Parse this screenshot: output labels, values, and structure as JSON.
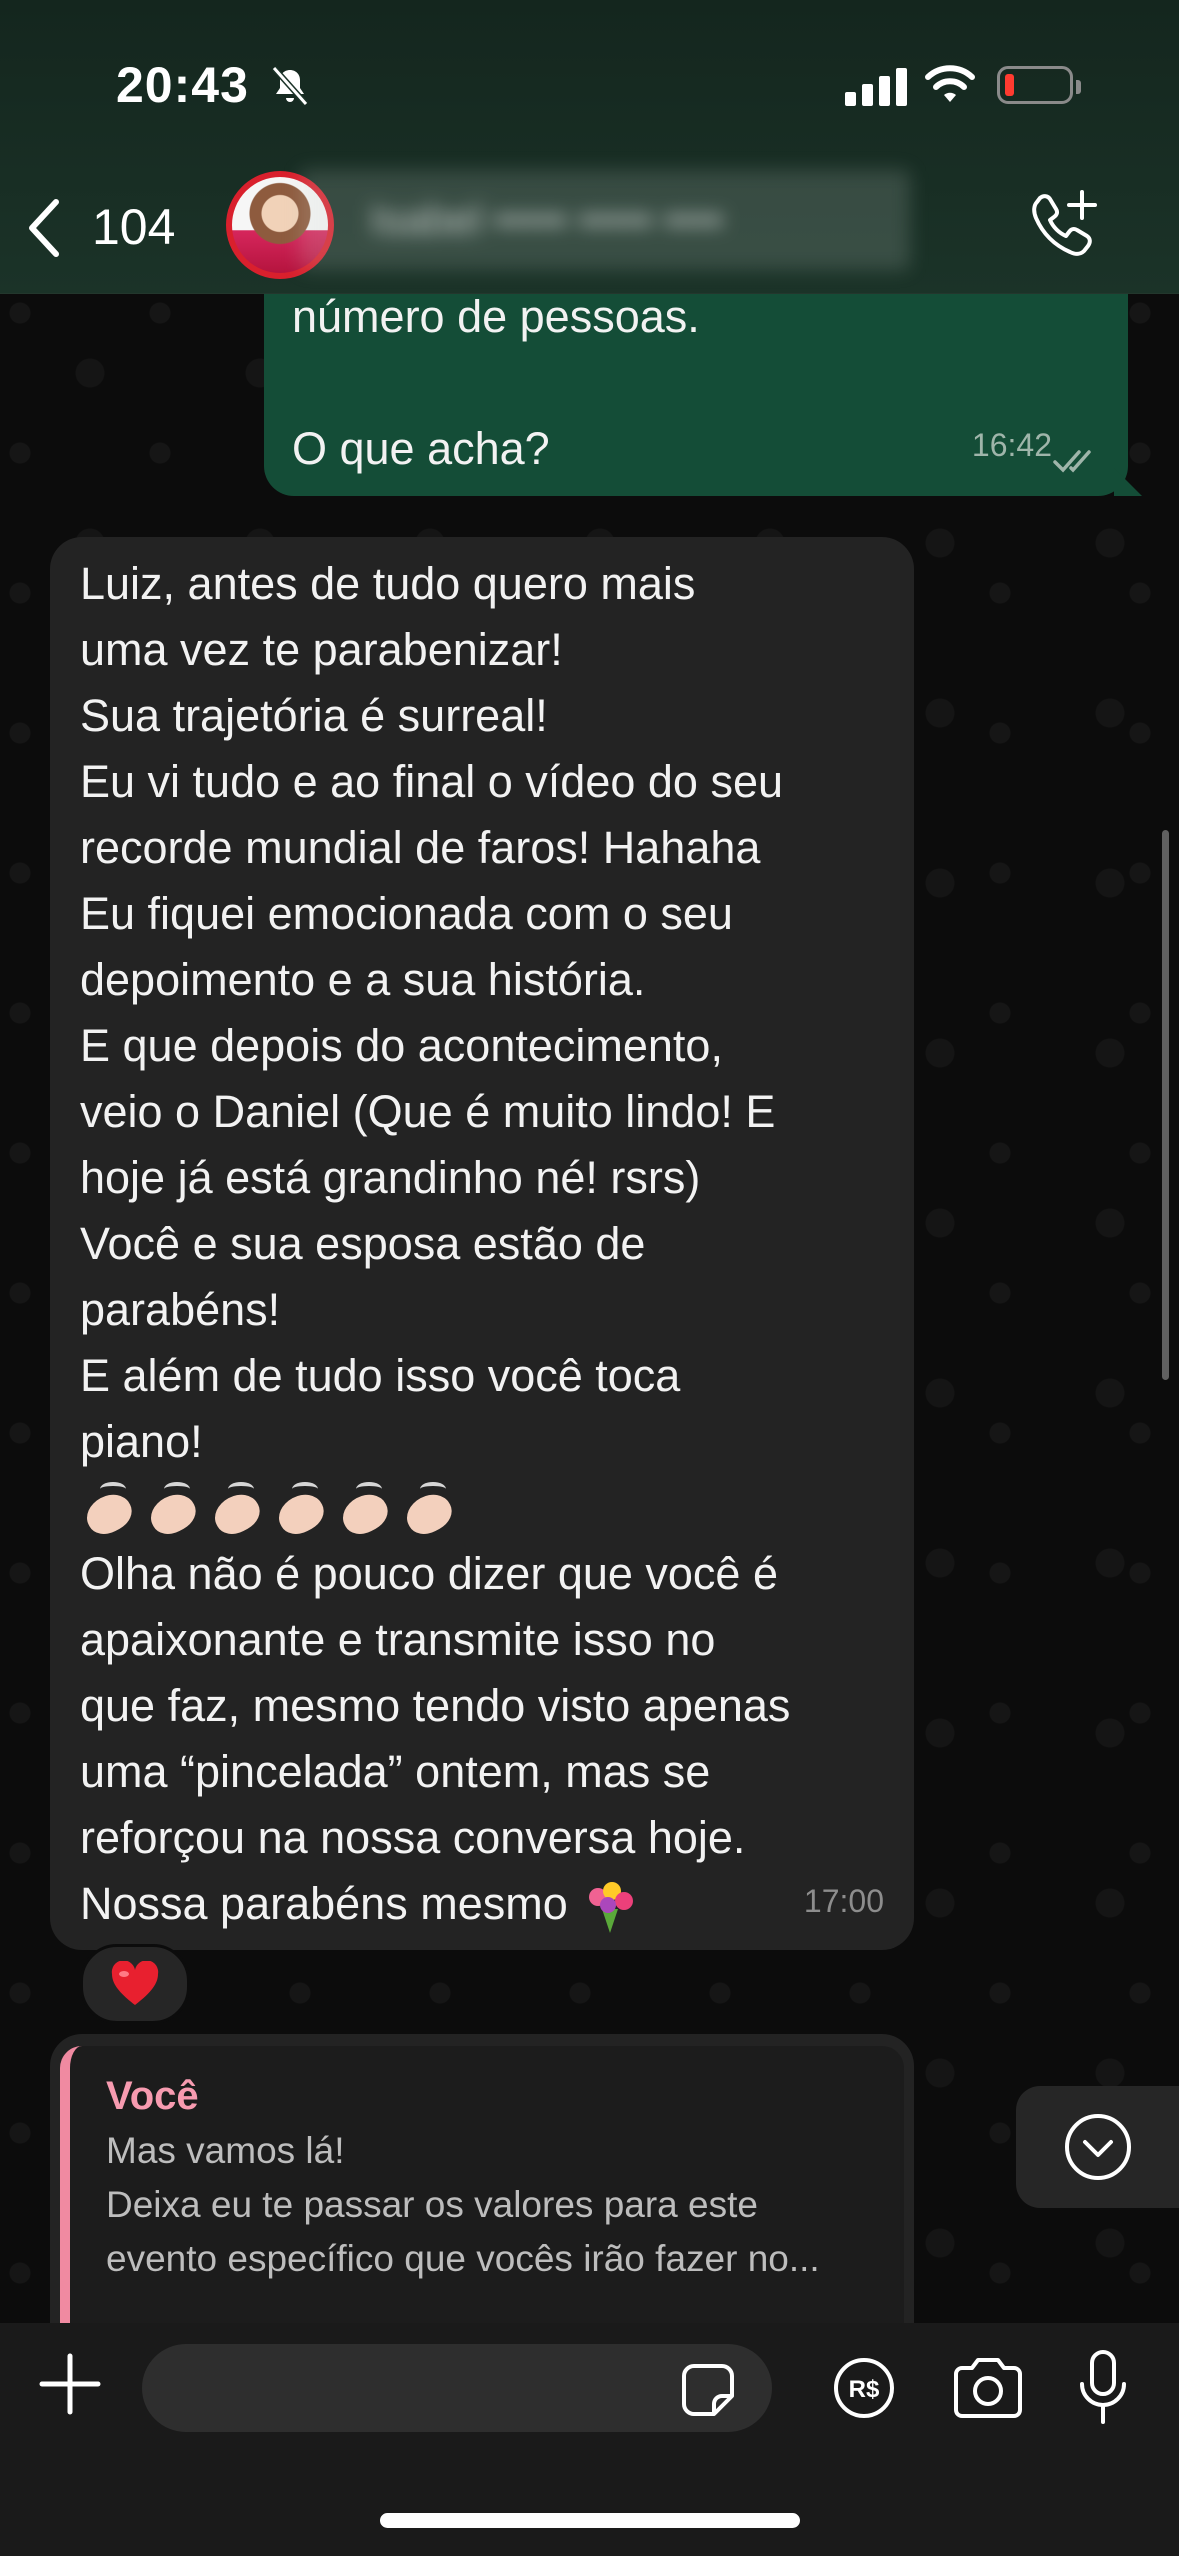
{
  "status_bar": {
    "time": "20:43"
  },
  "header": {
    "back_count": "104",
    "contact_name": "Isabel ••••• ••••• ••••"
  },
  "messages": {
    "outgoing": {
      "lines": [
        "número de pessoas.",
        "",
        "O que acha?"
      ],
      "time": "16:42"
    },
    "incoming": {
      "lines": [
        "Luiz, antes de tudo quero mais",
        "uma vez te parabenizar!",
        "Sua trajetória é surreal!",
        "Eu vi tudo e ao final o vídeo do seu",
        "recorde mundial de faros! Hahaha",
        "Eu fiquei emocionada com o seu",
        "depoimento e a sua história.",
        "E que depois do acontecimento,",
        "veio o Daniel (Que é muito lindo! E",
        "hoje já está grandinho né! rsrs)",
        "Você e sua esposa estão de",
        "parabéns!",
        "E além de tudo isso você toca",
        "piano!"
      ],
      "lines_after": [
        "Olha não é pouco dizer que você é",
        "apaixonante e transmite isso no",
        "que faz, mesmo tendo visto apenas",
        "uma “pincelada” ontem, mas se",
        "reforçou na nossa conversa hoje.",
        "Nossa parabéns mesmo"
      ],
      "time": "17:00",
      "reaction": "heart"
    },
    "quoted_reply": {
      "author": "Você",
      "lines": [
        "Mas vamos lá!",
        "Deixa eu te passar os valores para este",
        "evento específico que vocês irão fazer no..."
      ]
    }
  },
  "composer": {
    "placeholder": ""
  },
  "colors": {
    "outgoing_bubble": "#144d37",
    "incoming_bubble": "#232323",
    "quote_accent": "#f08aa1",
    "header_bg": "#1b3328"
  },
  "icons": [
    "mute-icon",
    "signal-icon",
    "wifi-icon",
    "battery-icon",
    "back-chevron-icon",
    "call-add-icon",
    "double-check-icon",
    "clap-emoji",
    "bouquet-emoji",
    "heart-icon",
    "chevron-down-icon",
    "plus-icon",
    "sticker-icon",
    "pix-icon",
    "camera-icon",
    "mic-icon"
  ]
}
